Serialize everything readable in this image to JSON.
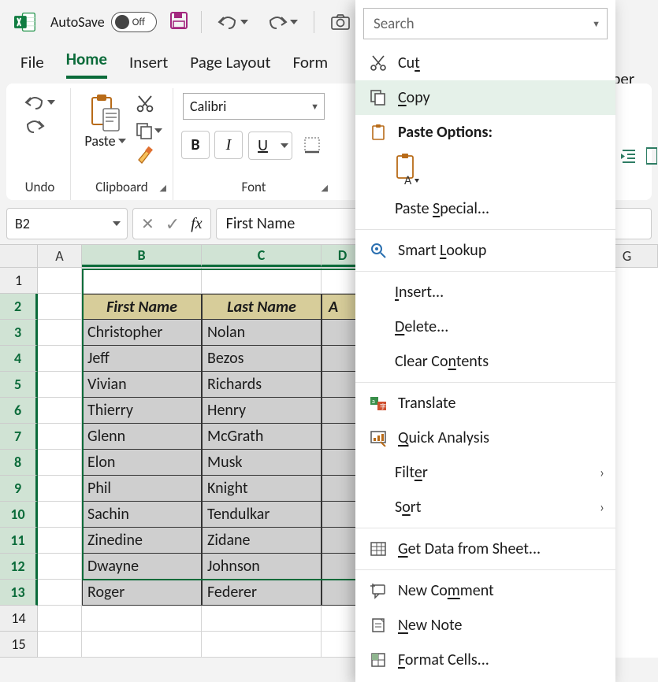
{
  "titlebar": {
    "autosave_label": "AutoSave",
    "toggle_text": "Off"
  },
  "tabs": {
    "file": "File",
    "home": "Home",
    "insert": "Insert",
    "page_layout": "Page Layout",
    "formulas_partial": "Form",
    "developer_partial": "eloper"
  },
  "ribbon": {
    "undo_label": "Undo",
    "clipboard_label": "Clipboard",
    "paste_label": "Paste",
    "font_label": "Font",
    "font_name": "Calibri",
    "bold": "B",
    "italic": "I",
    "underline": "U"
  },
  "formula_bar": {
    "name_box": "B2",
    "content": "First Name"
  },
  "columns": [
    "A",
    "B",
    "C",
    "D",
    "G"
  ],
  "grid": {
    "headers": [
      "First Name",
      "Last Name",
      "A"
    ],
    "rows": [
      [
        "Christopher",
        "Nolan"
      ],
      [
        "Jeff",
        "Bezos"
      ],
      [
        "Vivian",
        "Richards"
      ],
      [
        "Thierry",
        "Henry"
      ],
      [
        "Glenn",
        "McGrath"
      ],
      [
        "Elon",
        "Musk"
      ],
      [
        "Phil",
        "Knight"
      ],
      [
        "Sachin",
        "Tendulkar"
      ],
      [
        "Zinedine",
        "Zidane"
      ],
      [
        "Dwayne",
        "Johnson"
      ],
      [
        "Roger",
        "Federer"
      ]
    ]
  },
  "context_menu": {
    "search_placeholder": "Search",
    "cut": "Cut",
    "copy": "Copy",
    "paste_options": "Paste Options:",
    "paste_special": "Paste Special...",
    "smart_lookup": "Smart Lookup",
    "insert": "Insert...",
    "delete": "Delete...",
    "clear_contents": "Clear Contents",
    "translate": "Translate",
    "quick_analysis": "Quick Analysis",
    "filter": "Filter",
    "sort": "Sort",
    "get_data": "Get Data from Sheet...",
    "new_comment": "New Comment",
    "new_note": "New Note",
    "format_cells": "Format Cells..."
  }
}
